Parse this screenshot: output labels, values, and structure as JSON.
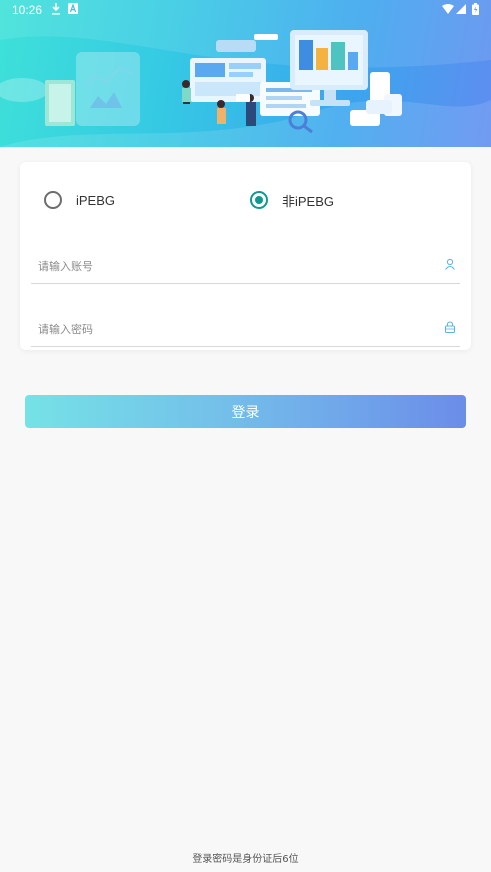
{
  "status_bar": {
    "time": "10:26",
    "icons": [
      "download-icon",
      "notification-a-icon",
      "wifi-icon",
      "cellular-signal-icon",
      "battery-icon"
    ]
  },
  "banner": {
    "illustration": "data-analytics-dashboard-illustration",
    "colors": {
      "start": "#3ee1d9",
      "end": "#5f8df0"
    }
  },
  "login_form": {
    "user_type_options": [
      {
        "label": "iPEBG",
        "selected": false
      },
      {
        "label": "非iPEBG",
        "selected": true
      }
    ],
    "account": {
      "placeholder": "请输入账号",
      "value": "",
      "icon": "user-icon"
    },
    "password": {
      "placeholder": "请输入密码",
      "value": "",
      "icon": "lock-icon"
    },
    "submit_label": "登录"
  },
  "footer_hint": "登录密码是身份证后6位",
  "colors": {
    "accent": "#0e9a8e",
    "button_start": "#75e2e6",
    "button_end": "#6b8de9",
    "background": "#f8f8f8"
  }
}
